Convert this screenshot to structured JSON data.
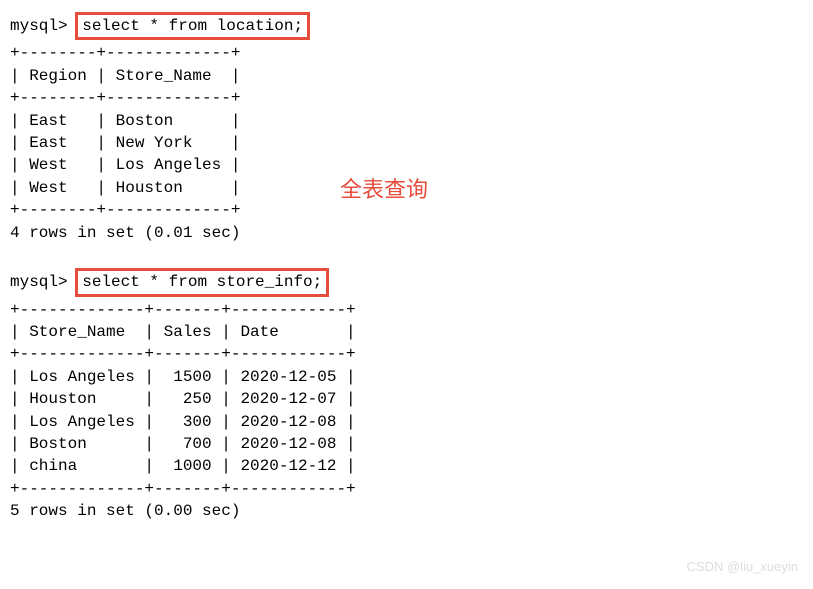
{
  "prompt1": {
    "prompt": "mysql>",
    "query": "select * from location;"
  },
  "table1": {
    "border": "+--------+-------------+",
    "header": "| Region | Store_Name  |",
    "rows": [
      "| East   | Boston      |",
      "| East   | New York    |",
      "| West   | Los Angeles |",
      "| West   | Houston     |"
    ],
    "footer": "4 rows in set (0.01 sec)"
  },
  "annotation1": "全表查询",
  "prompt2": {
    "prompt": "mysql>",
    "query": "select * from store_info;"
  },
  "table2": {
    "border": "+-------------+-------+------------+",
    "header": "| Store_Name  | Sales | Date       |",
    "rows": [
      "| Los Angeles |  1500 | 2020-12-05 |",
      "| Houston     |   250 | 2020-12-07 |",
      "| Los Angeles |   300 | 2020-12-08 |",
      "| Boston      |   700 | 2020-12-08 |",
      "| china       |  1000 | 2020-12-12 |"
    ],
    "footer": "5 rows in set (0.00 sec)"
  },
  "watermark": "CSDN @liu_xueyin",
  "chart_data": [
    {
      "type": "table",
      "title": "location",
      "columns": [
        "Region",
        "Store_Name"
      ],
      "rows": [
        [
          "East",
          "Boston"
        ],
        [
          "East",
          "New York"
        ],
        [
          "West",
          "Los Angeles"
        ],
        [
          "West",
          "Houston"
        ]
      ]
    },
    {
      "type": "table",
      "title": "store_info",
      "columns": [
        "Store_Name",
        "Sales",
        "Date"
      ],
      "rows": [
        [
          "Los Angeles",
          1500,
          "2020-12-05"
        ],
        [
          "Houston",
          250,
          "2020-12-07"
        ],
        [
          "Los Angeles",
          300,
          "2020-12-08"
        ],
        [
          "Boston",
          700,
          "2020-12-08"
        ],
        [
          "china",
          1000,
          "2020-12-12"
        ]
      ]
    }
  ]
}
